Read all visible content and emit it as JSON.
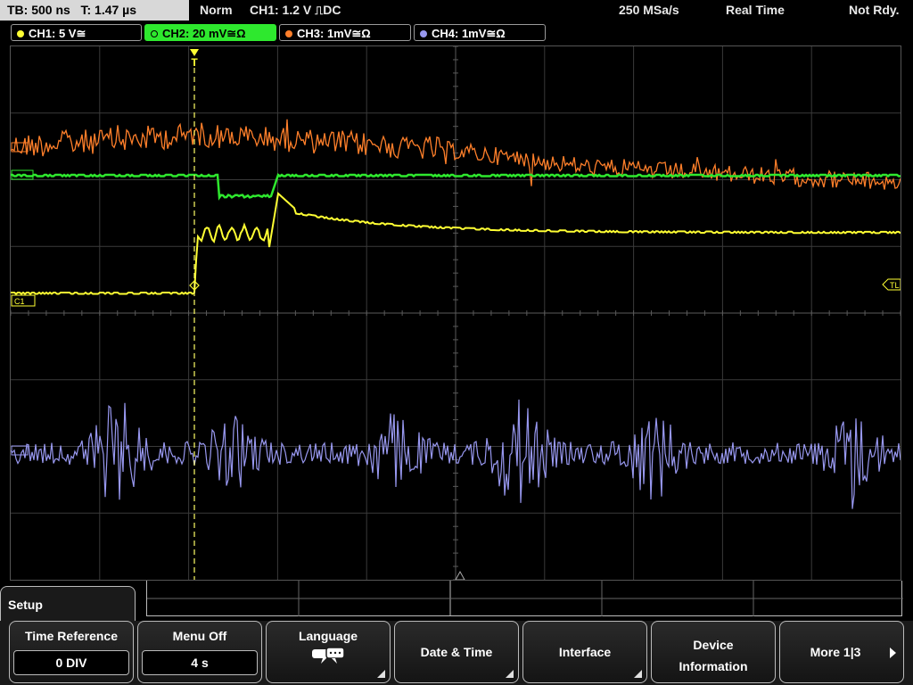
{
  "status": {
    "timebase": "TB: 500 ns",
    "trigger_time": "T: 1.47 µs",
    "mode": "Norm",
    "trigger_setting": "CH1: 1.2 V",
    "trigger_coupling": "DC",
    "sample_rate": "250 MSa/s",
    "acq_mode": "Real Time",
    "ready_state": "Not Rdy."
  },
  "channels": [
    {
      "label": "CH1: 5 V≅",
      "color": "#ffff33",
      "active": false
    },
    {
      "label": "CH2: 20 mV≅Ω",
      "color": "#2ee82e",
      "active": true
    },
    {
      "label": "CH3: 1mV≅Ω",
      "color": "#ff7f2a",
      "active": false
    },
    {
      "label": "CH4: 1mV≅Ω",
      "color": "#9898f0",
      "active": false
    }
  ],
  "screen": {
    "ch1_marker": "C1",
    "trigger_level_marker": "TL",
    "trigger_position_marker": "T"
  },
  "menu": {
    "setup_label": "Setup",
    "softkeys": [
      {
        "title": "Time Reference",
        "value": "0 DIV"
      },
      {
        "title": "Menu Off",
        "value": "4 s"
      },
      {
        "title": "Language",
        "icon": "speech-bubbles-icon"
      },
      {
        "title": "Date & Time"
      },
      {
        "title": "Interface"
      },
      {
        "title_line1": "Device",
        "title_line2": "Information"
      },
      {
        "title": "More 1|3"
      }
    ]
  }
}
